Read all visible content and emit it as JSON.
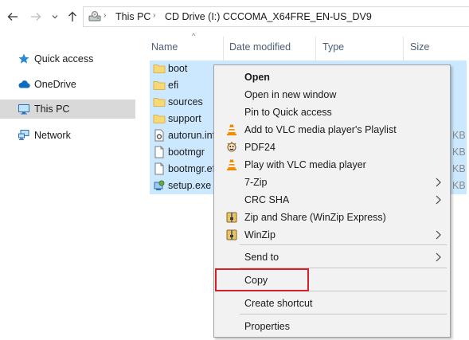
{
  "colors": {
    "selection": "#cce8ff",
    "sidebar_selected": "#d9d9d9",
    "menu_bg": "#f2f2f2",
    "highlight": "#d6202a",
    "folder": "#f8d775"
  },
  "nav": {
    "back_icon": "arrow-left-icon",
    "forward_icon": "arrow-right-icon",
    "recent_icon": "chevron-down-icon",
    "up_icon": "arrow-up-icon"
  },
  "address": {
    "icon": "drive-icon",
    "segments": [
      "This PC",
      "CD Drive (I:) CCCOMA_X64FRE_EN-US_DV9"
    ]
  },
  "sidebar": {
    "items": [
      {
        "label": "Quick access",
        "icon": "star-icon"
      },
      {
        "label": "OneDrive",
        "icon": "cloud-icon"
      },
      {
        "label": "This PC",
        "icon": "computer-icon",
        "selected": true
      },
      {
        "label": "Network",
        "icon": "network-icon"
      }
    ]
  },
  "columns": {
    "name": "Name",
    "date": "Date modified",
    "type": "Type",
    "size": "Size"
  },
  "files": [
    {
      "name": "boot",
      "icon": "folder-icon"
    },
    {
      "name": "efi",
      "icon": "folder-icon"
    },
    {
      "name": "sources",
      "icon": "folder-icon"
    },
    {
      "name": "support",
      "icon": "folder-icon"
    },
    {
      "name": "autorun.inf",
      "icon": "settings-file-icon",
      "size_unit": "KB"
    },
    {
      "name": "bootmgr",
      "icon": "file-icon",
      "size_unit": "KB"
    },
    {
      "name": "bootmgr.efi",
      "icon": "file-icon",
      "size_unit": "KB"
    },
    {
      "name": "setup.exe",
      "icon": "setup-icon",
      "size_unit": "KB"
    }
  ],
  "context_menu": {
    "items": [
      {
        "label": "Open",
        "bold": true
      },
      {
        "label": "Open in new window"
      },
      {
        "label": "Pin to Quick access"
      },
      {
        "label": "Add to VLC media player's Playlist",
        "icon": "vlc-icon"
      },
      {
        "label": "PDF24",
        "icon": "pdf24-icon"
      },
      {
        "label": "Play with VLC media player",
        "icon": "vlc-icon"
      },
      {
        "label": "7-Zip",
        "submenu": true
      },
      {
        "label": "CRC SHA",
        "submenu": true
      },
      {
        "label": "Zip and Share (WinZip Express)",
        "icon": "winzip-icon"
      },
      {
        "label": "WinZip",
        "icon": "winzip-icon",
        "submenu": true
      },
      {
        "label": "Send to",
        "submenu": true
      },
      {
        "label": "Copy",
        "highlighted": true
      },
      {
        "label": "Create shortcut"
      },
      {
        "label": "Properties"
      }
    ]
  }
}
